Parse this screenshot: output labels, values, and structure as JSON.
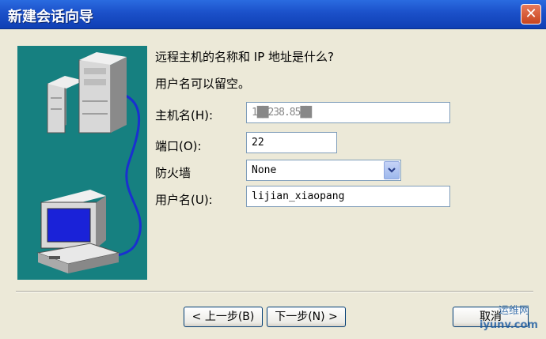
{
  "window": {
    "title": "新建会话向导",
    "close_glyph": "✕"
  },
  "prompt": {
    "question": "远程主机的名称和 IP 地址是什么?",
    "hint": "用户名可以留空。"
  },
  "form": {
    "host_label": "主机名(H):",
    "host_value": "1██238.85██",
    "port_label": "端口(O):",
    "port_value": "22",
    "firewall_label": "防火墙",
    "firewall_value": "None",
    "user_label": "用户名(U):",
    "user_value": "lijian_xiaopang"
  },
  "buttons": {
    "back": "< 上一步(B)",
    "next": "下一步(N) >",
    "cancel": "取消"
  },
  "watermark": {
    "line1": "运维网",
    "line2": "iyunv.com"
  },
  "colors": {
    "titlebar": "#1b50c9",
    "art_bg": "#168080",
    "dialog_bg": "#ece9d8"
  }
}
